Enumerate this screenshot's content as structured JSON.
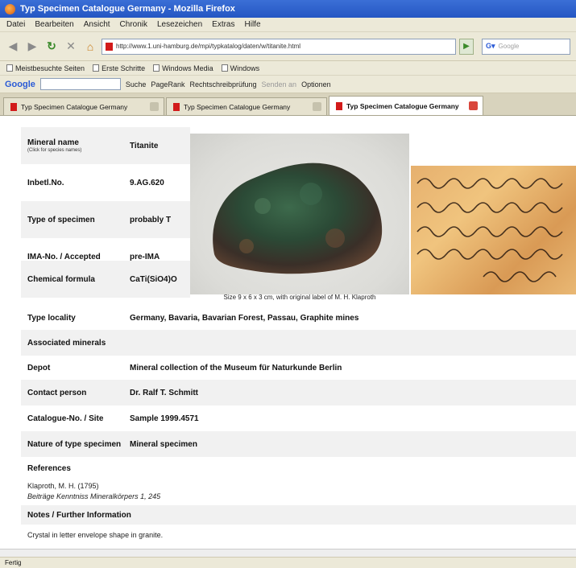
{
  "window": {
    "title": "Typ Specimen Catalogue Germany - Mozilla Firefox"
  },
  "menu": [
    "Datei",
    "Bearbeiten",
    "Ansicht",
    "Chronik",
    "Lesezeichen",
    "Extras",
    "Hilfe"
  ],
  "nav": {
    "url": "http://www.1.uni-hamburg.de/mpi/typkatalog/daten/w/titanite.html",
    "search_placeholder": "Google"
  },
  "bookmarks": [
    "Meistbesuchte Seiten",
    "Erste Schritte",
    "Windows Media",
    "Windows"
  ],
  "googlebar": {
    "logo": "Google",
    "items": [
      "Suche",
      "PageRank",
      "Rechtschreibprüfung",
      "Senden an",
      "Optionen"
    ]
  },
  "tabs": [
    {
      "label": "Typ Specimen Catalogue Germany",
      "active": false
    },
    {
      "label": "Typ Specimen Catalogue Germany",
      "active": false
    },
    {
      "label": "Typ Specimen Catalogue Germany",
      "active": true
    }
  ],
  "record": {
    "mineral_name_label": "Mineral name",
    "mineral_name_sub": "(Click for species names)",
    "mineral_name": "Titanite",
    "inv_label": "Inbetl.No.",
    "inv_value": "9.AG.620",
    "type_label": "Type of specimen",
    "type_value": "probably T",
    "ima_label": "IMA-No. / Accepted",
    "ima_value": "pre-IMA",
    "chem_label": "Chemical formula",
    "chem_value": "CaTi(SiO4)O",
    "photo_caption": "Size 9 x 6 x 3 cm, with original label of M. H. Klaproth",
    "locality_label": "Type locality",
    "locality_value": "Germany, Bavaria, Bavarian Forest, Passau, Graphite mines",
    "assoc_label": "Associated minerals",
    "depot_label": "Depot",
    "depot_value": "Mineral collection of the Museum für Naturkunde Berlin",
    "contact_label": "Contact person",
    "contact_value": "Dr. Ralf T. Schmitt",
    "catalog_label": "Catalogue-No. / Site",
    "catalog_value": "Sample 1999.4571",
    "nature_label": "Nature of type specimen",
    "nature_value": "Mineral specimen",
    "refs_label": "References",
    "ref_line1": "Klaproth, M. H. (1795)",
    "ref_line2": "Beiträge Kenntniss Mineralkörpers 1, 245",
    "notes_label": "Notes / Further Information",
    "notes_value": "Crystal in letter envelope shape in granite."
  },
  "status": "Fertig"
}
